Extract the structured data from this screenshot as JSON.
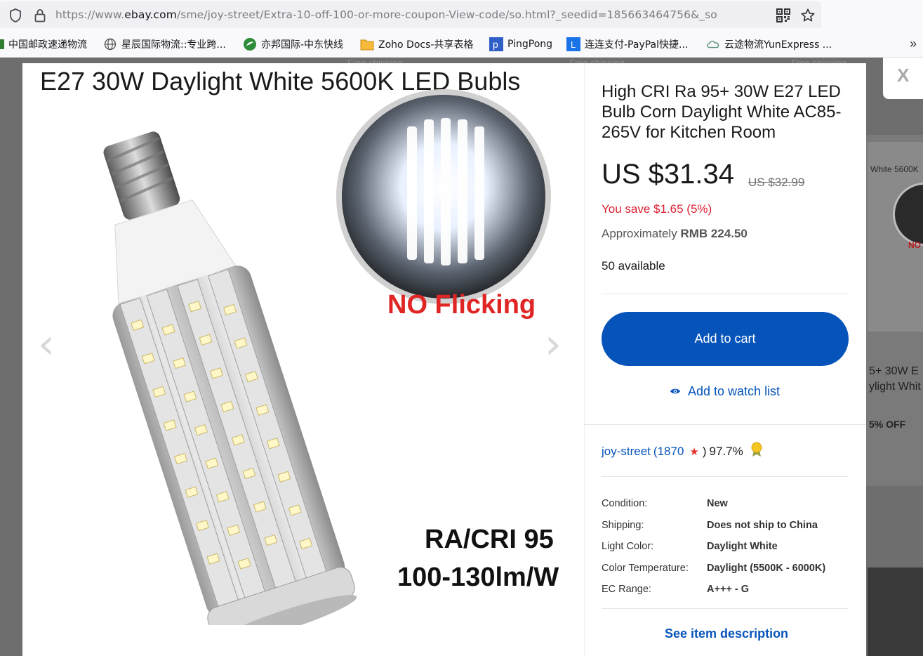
{
  "browser": {
    "url_prefix": "https://www.",
    "url_domain": "ebay.com",
    "url_rest": "/sme/joy-street/Extra-10-off-100-or-more-coupon-View-code/so.html?_seedid=185663464756&_so"
  },
  "bookmarks": [
    {
      "label": "中国邮政速递物流"
    },
    {
      "label": "星辰国际物流::专业跨..."
    },
    {
      "label": "亦邦国际-中东快线"
    },
    {
      "label": "Zoho Docs-共享表格"
    },
    {
      "label": "PingPong"
    },
    {
      "label": "连连支付-PayPal快捷..."
    },
    {
      "label": "云途物流YunExpress ..."
    }
  ],
  "background": {
    "free_shipping": "Free shipping",
    "thumb_text": "White 5600K",
    "thumb_red": "NO",
    "title_lines": [
      "5+ 30W E",
      "ylight Whit"
    ],
    "off": "5% OFF"
  },
  "close_label": "X",
  "gallery": {
    "headline": "E27 30W Daylight White 5600K LED Bubls",
    "no_flicking": "NO Flicking",
    "ra_cri": "RA/CRI 95",
    "lumens": "100-130lm/W",
    "prev_arrow": "‹",
    "next_arrow": "›"
  },
  "item": {
    "title": "High CRI Ra 95+ 30W E27 LED Bulb Corn Daylight White AC85-265V for Kitchen Room",
    "price": "US $31.34",
    "price_was": "US $32.99",
    "savings": "You save $1.65 (5%)",
    "approx_label": "Approximately",
    "approx_value": "RMB 224.50",
    "available": "50 available",
    "add_to_cart": "Add to cart",
    "add_to_watch": "Add to watch list"
  },
  "seller": {
    "name": "joy-street",
    "open_paren": "(",
    "feedback_count": "1870",
    "close_paren": ")",
    "positive": "97.7%"
  },
  "specs": [
    {
      "key": "Condition:",
      "value": "New"
    },
    {
      "key": "Shipping:",
      "value": "Does not ship to China"
    },
    {
      "key": "Light Color:",
      "value": "Daylight White"
    },
    {
      "key": "Color Temperature:",
      "value": "Daylight (5500K - 6000K)"
    },
    {
      "key": "EC Range:",
      "value": "A+++ - G"
    }
  ],
  "see_description": "See item description",
  "colors": {
    "ebay_blue": "#0654ba",
    "savings_red": "#dd1e31",
    "overlay": "#6e6e6e"
  }
}
